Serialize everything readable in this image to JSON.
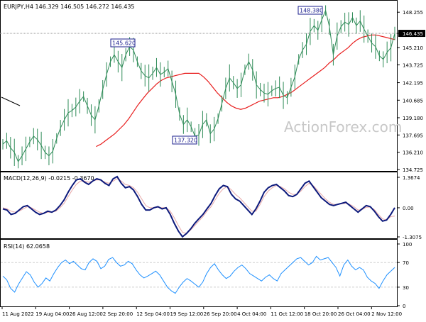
{
  "header": {
    "symbol_line": "EURJPY,H4  146.329 146.505 146.272 146.435",
    "macd_label": "MACD(12,26,9) -0.0215 -0.3670",
    "rsi_label": "RSI(14) 62.0658"
  },
  "watermark": "ActionForex.com",
  "colors": {
    "price": "#2e8b57",
    "sma": "#e81d1d",
    "macd_line": "#0d1a7c",
    "macd_signal": "#e8a8a8",
    "rsi": "#1e90ff",
    "current_price_bg": "#000000",
    "callout_border": "#1b1f8e"
  },
  "chart_data": [
    {
      "type": "line",
      "panel": "price",
      "series": [
        {
          "values": [
            136.9,
            137.2,
            136.6,
            136.2,
            135.4,
            135.9,
            136.5,
            137.1,
            137.6,
            137.3,
            136.8,
            136.2,
            135.9,
            136.3,
            137.4,
            138.3,
            139.0,
            139.6,
            139.8,
            140.1,
            140.6,
            141.0,
            140.2,
            139.4,
            139.0,
            140.2,
            141.6,
            142.9,
            144.0,
            144.6,
            144.0,
            143.5,
            144.6,
            145.3,
            145.0,
            144.0,
            143.2,
            142.8,
            142.6,
            143.0,
            143.5,
            142.9,
            143.1,
            143.4,
            142.3,
            141.2,
            139.5,
            138.6,
            139.0,
            138.4,
            137.6,
            137.7,
            138.6,
            139.0,
            137.8,
            138.2,
            139.1,
            140.4,
            141.7,
            142.6,
            142.2,
            141.7,
            142.0,
            143.3,
            144.0,
            143.3,
            142.0,
            141.6,
            141.3,
            141.2,
            141.5,
            141.7,
            141.8,
            141.1,
            140.9,
            141.8,
            142.7,
            144.2,
            145.0,
            145.5,
            146.6,
            147.1,
            146.7,
            147.6,
            148.4,
            147.0,
            144.6,
            146.2,
            147.0,
            147.4,
            147.2,
            147.8,
            147.1,
            147.5,
            146.8,
            146.2,
            145.6,
            145.3,
            144.5,
            144.2,
            144.8,
            145.2,
            146.435
          ]
        },
        {
          "name": "SMA",
          "values": [
            null,
            null,
            null,
            null,
            null,
            null,
            null,
            null,
            null,
            null,
            null,
            null,
            null,
            null,
            null,
            null,
            null,
            null,
            null,
            null,
            136.7,
            136.9,
            137.2,
            137.5,
            137.8,
            138.2,
            138.6,
            139.1,
            139.7,
            140.3,
            140.8,
            141.3,
            141.7,
            142.1,
            142.4,
            142.6,
            142.7,
            142.8,
            142.9,
            143.0,
            143.0,
            143.0,
            143.0,
            142.7,
            142.3,
            141.8,
            141.3,
            140.9,
            140.5,
            140.2,
            140.0,
            139.9,
            140.0,
            140.2,
            140.4,
            140.6,
            140.7,
            140.8,
            140.9,
            140.9,
            141.0,
            141.2,
            141.4,
            141.7,
            142.0,
            142.3,
            142.6,
            142.9,
            143.2,
            143.5,
            143.9,
            144.2,
            144.6,
            144.9,
            145.2,
            145.6,
            145.9,
            146.1,
            146.2,
            146.3,
            146.3,
            146.2,
            146.1,
            146.0,
            145.9
          ]
        }
      ],
      "ylim": [
        134.725,
        149.0
      ],
      "ticks": [
        "148.255",
        "146.435",
        "145.210",
        "143.725",
        "142.195",
        "140.685",
        "139.180",
        "137.695",
        "136.210",
        "134.725"
      ],
      "annotations": [
        "145.620",
        "137.320",
        "148.380"
      ]
    },
    {
      "type": "line",
      "panel": "macd",
      "series": [
        {
          "values": [
            -0.05,
            -0.1,
            -0.3,
            -0.25,
            -0.1,
            0.05,
            0.1,
            -0.05,
            -0.2,
            -0.3,
            -0.25,
            -0.15,
            -0.2,
            -0.1,
            0.1,
            0.35,
            0.7,
            1.0,
            1.25,
            1.3,
            1.15,
            1.05,
            1.2,
            1.3,
            1.25,
            1.1,
            1.0,
            1.3,
            1.4,
            1.1,
            0.9,
            0.95,
            0.8,
            0.5,
            0.15,
            -0.1,
            -0.1,
            0.0,
            0.05,
            -0.05,
            0.0,
            -0.3,
            -0.7,
            -1.05,
            -1.3,
            -1.15,
            -0.95,
            -0.7,
            -0.5,
            -0.3,
            -0.05,
            0.2,
            0.55,
            0.85,
            1.0,
            0.95,
            0.6,
            0.4,
            0.3,
            0.1,
            -0.1,
            -0.3,
            -0.05,
            0.3,
            0.7,
            0.9,
            1.0,
            1.05,
            0.9,
            0.75,
            0.55,
            0.5,
            0.6,
            0.85,
            1.1,
            1.2,
            0.95,
            0.7,
            0.45,
            0.3,
            0.15,
            0.1,
            0.15,
            0.2,
            0.25,
            0.1,
            -0.05,
            -0.2,
            -0.05,
            0.1,
            0.05,
            -0.15,
            -0.4,
            -0.6,
            -0.55,
            -0.3,
            0.0
          ]
        },
        {
          "values": [
            0.0,
            -0.05,
            -0.15,
            -0.2,
            -0.15,
            -0.05,
            0.05,
            0.0,
            -0.1,
            -0.2,
            -0.25,
            -0.2,
            -0.2,
            -0.15,
            0.0,
            0.2,
            0.5,
            0.8,
            1.05,
            1.2,
            1.2,
            1.15,
            1.2,
            1.25,
            1.25,
            1.15,
            1.1,
            1.2,
            1.3,
            1.2,
            1.05,
            1.0,
            0.9,
            0.7,
            0.4,
            0.1,
            0.0,
            0.0,
            0.02,
            0.0,
            0.0,
            -0.15,
            -0.45,
            -0.8,
            -1.1,
            -1.15,
            -1.0,
            -0.8,
            -0.6,
            -0.4,
            -0.15,
            0.05,
            0.35,
            0.65,
            0.85,
            0.95,
            0.8,
            0.6,
            0.45,
            0.25,
            0.05,
            -0.15,
            -0.15,
            0.15,
            0.5,
            0.75,
            0.9,
            1.0,
            0.95,
            0.85,
            0.7,
            0.6,
            0.6,
            0.75,
            0.95,
            1.1,
            1.0,
            0.8,
            0.6,
            0.4,
            0.25,
            0.15,
            0.15,
            0.18,
            0.2,
            0.15,
            0.05,
            -0.1,
            -0.08,
            0.02,
            0.03,
            -0.08,
            -0.3,
            -0.5,
            -0.55,
            -0.4,
            -0.37
          ]
        }
      ],
      "ylim": [
        -1.3075,
        1.3674
      ],
      "ticks": [
        "1.3674",
        "0.00",
        "-1.3075"
      ]
    },
    {
      "type": "line",
      "panel": "rsi",
      "series": [
        {
          "values": [
            48,
            42,
            28,
            22,
            35,
            45,
            55,
            50,
            38,
            30,
            36,
            45,
            40,
            52,
            62,
            70,
            74,
            68,
            72,
            66,
            60,
            58,
            70,
            76,
            72,
            60,
            64,
            75,
            78,
            70,
            64,
            66,
            72,
            68,
            58,
            50,
            45,
            48,
            52,
            56,
            50,
            40,
            30,
            24,
            20,
            30,
            38,
            44,
            40,
            35,
            30,
            38,
            52,
            62,
            68,
            58,
            50,
            44,
            48,
            56,
            62,
            66,
            60,
            52,
            48,
            44,
            40,
            46,
            50,
            44,
            40,
            52,
            58,
            64,
            70,
            76,
            78,
            72,
            66,
            70,
            80,
            74,
            76,
            78,
            70,
            62,
            48,
            66,
            74,
            64,
            58,
            62,
            58,
            46,
            40,
            36,
            28,
            40,
            50,
            56,
            62
          ]
        }
      ],
      "ylim": [
        0,
        100
      ],
      "ticks": [
        "100",
        "70",
        "30",
        "0"
      ]
    }
  ],
  "x_axis": {
    "labels": [
      "11 Aug 2022",
      "19 Aug 04:00",
      "26 Aug 12:00",
      "2 Sep 20:00",
      "12 Sep 04:00",
      "19 Sep 12:00",
      "26 Sep 20:00",
      "4 Oct 04:00",
      "11 Oct 12:00",
      "18 Oct 20:00",
      "26 Oct 04:00",
      "2 Nov 12:00"
    ]
  }
}
